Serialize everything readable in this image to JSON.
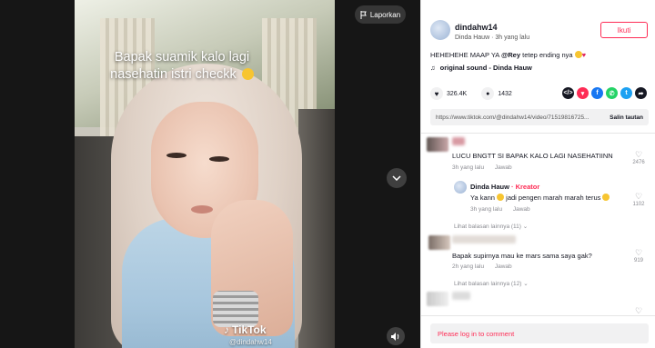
{
  "video": {
    "caption": "Bapak suamik kalo lagi nasehatin istri checkk",
    "report_label": "Laporkan",
    "watermark_brand": "TikTok",
    "watermark_handle": "@dindahw14"
  },
  "author": {
    "username": "dindahw14",
    "display_name": "Dinda Hauw",
    "time_ago": "3h yang lalu",
    "follow_label": "Ikuti"
  },
  "post": {
    "description_prefix": "HEHEHEHE MAAP YA ",
    "mention": "@Rey",
    "description_suffix": " tetep ending nya",
    "sound": "original sound - Dinda Hauw",
    "likes": "326.4K",
    "comments": "1432",
    "link": "https://www.tiktok.com/@dindahw14/video/71519816725...",
    "copy_link_label": "Salin tautan"
  },
  "share_icons": [
    {
      "name": "embed-icon",
      "color": "#161823",
      "glyph": "</>"
    },
    {
      "name": "send-icon",
      "color": "#fe2c55",
      "glyph": "▾"
    },
    {
      "name": "facebook-icon",
      "color": "#1877f2",
      "glyph": "f"
    },
    {
      "name": "whatsapp-icon",
      "color": "#25d366",
      "glyph": "✆"
    },
    {
      "name": "twitter-icon",
      "color": "#1da1f2",
      "glyph": "t"
    },
    {
      "name": "share-arrow-icon",
      "color": "#161823",
      "glyph": "➦"
    }
  ],
  "comments": {
    "c1": {
      "text": "LUCU BNGTT SI BAPAK KALO LAGI NASEHATIINN",
      "time": "3h yang lalu",
      "reply": "Jawab",
      "likes": "2476"
    },
    "c1_reply": {
      "name": "Dinda Hauw",
      "tag": "· Kreator",
      "text_a": "Ya kann",
      "text_b": " jadi pengen marah marah terus ",
      "time": "3h yang lalu",
      "reply": "Jawab",
      "likes": "1102"
    },
    "c1_more": "Lihat balasan lainnya (11)",
    "c2": {
      "text": "Bapak supirnya mau ke mars sama saya gak?",
      "time": "2h yang lalu",
      "reply": "Jawab",
      "likes": "919"
    },
    "c2_more": "Lihat balasan lainnya (12)"
  },
  "login_prompt": "Please log in to comment",
  "colors": {
    "accent": "#fe2c55",
    "text": "#161823",
    "muted": "#8a8b91"
  }
}
